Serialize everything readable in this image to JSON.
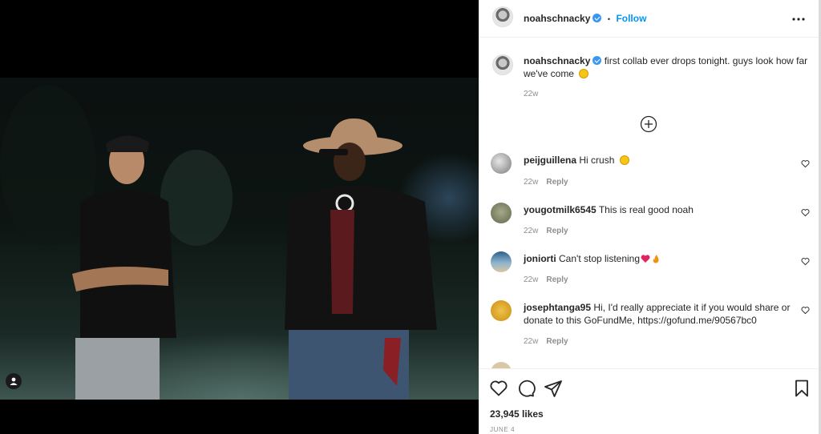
{
  "post": {
    "owner": "noahschnacky",
    "follow_label": "Follow",
    "separator": "•",
    "more_icon": "more-horizontal-icon",
    "caption": "first collab ever drops tonight. guys look how far we've come",
    "caption_age": "22w",
    "likes": "23,945 likes",
    "date": "JUNE 4"
  },
  "comments": [
    {
      "user": "peijguillena",
      "text": "Hi crush",
      "age": "22w",
      "reply": "Reply",
      "emoji": "heart-eyes-emoji"
    },
    {
      "user": "yougotmilk6545",
      "text": "This is real good noah",
      "age": "22w",
      "reply": "Reply"
    },
    {
      "user": "joniorti",
      "text": "Can't stop listening",
      "age": "22w",
      "reply": "Reply",
      "emoji": "heart-fire-emoji"
    },
    {
      "user": "josephtanga95",
      "text": "Hi, I'd really appreciate it if you would share or donate to this GoFundMe, https://gofund.me/90567bc0",
      "age": "22w",
      "reply": "Reply"
    }
  ],
  "colors": {
    "accent": "#0095f6",
    "verified": "#3897f0",
    "muted": "#8e8e8e"
  }
}
